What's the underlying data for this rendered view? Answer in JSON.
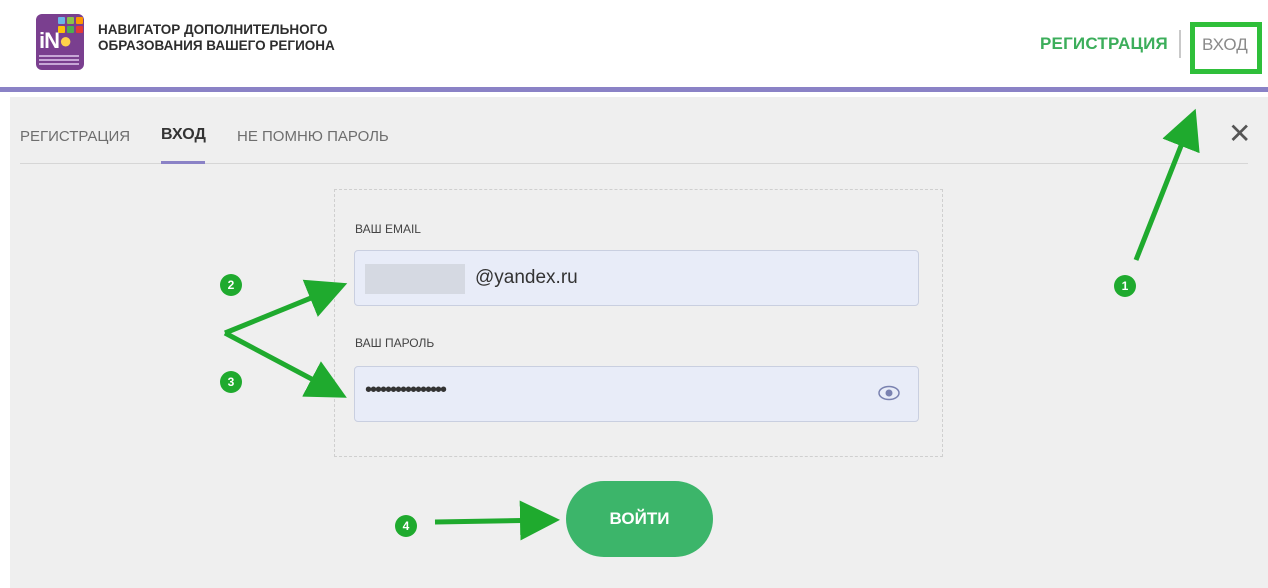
{
  "header": {
    "brand_line1": "НАВИГАТОР ДОПОЛНИТЕЛЬНОГО",
    "brand_line2": "ОБРАЗОВАНИЯ ВАШЕГО РЕГИОНА",
    "logo_text": "iN",
    "register_label": "РЕГИСТРАЦИЯ",
    "login_label": "ВХОД"
  },
  "tabs": [
    {
      "label": "РЕГИСТРАЦИЯ"
    },
    {
      "label": "ВХОД",
      "active": true
    },
    {
      "label": "НЕ ПОМНЮ ПАРОЛЬ"
    }
  ],
  "close_glyph": "✕",
  "form": {
    "email_label": "ВАШ EMAIL",
    "email_value": "@yandex.ru",
    "password_label": "ВАШ ПАРОЛЬ",
    "password_value": "••••••••••••••••",
    "submit_label": "ВОЙТИ"
  },
  "annotations": [
    {
      "number": "1"
    },
    {
      "number": "2"
    },
    {
      "number": "3"
    },
    {
      "number": "4"
    }
  ],
  "colors": {
    "accent_green": "#3cae5b",
    "annotation_green": "#1faa2e",
    "header_border": "#8a82c6",
    "logo_purple": "#7a3f8f"
  },
  "icons": [
    "close-icon",
    "eye-icon"
  ]
}
